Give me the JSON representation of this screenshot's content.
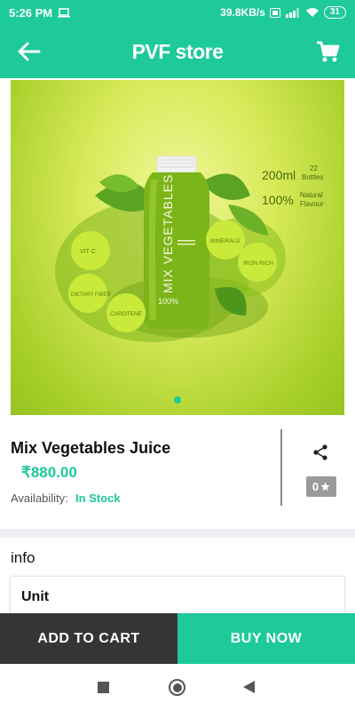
{
  "status_bar": {
    "time": "5:26 PM",
    "net_speed": "39.8KB/s",
    "battery": "31"
  },
  "app_bar": {
    "title": "PVF store",
    "back_icon": "arrow-left-icon",
    "cart_icon": "shopping-cart-icon"
  },
  "hero": {
    "bottle_label": "MIX VEGETABLES",
    "bottle_small": "100%",
    "volume": "200ml",
    "bottles_count": "22",
    "bottles_word": "Bottles",
    "natural_pct": "100%",
    "natural_word": "Natural",
    "flavour_word": "Flavour",
    "badges": [
      "VIT C",
      "DIETARY FIBER",
      "CAROTENE",
      "MINERALS",
      "IRON RICH"
    ],
    "slide_count": 1,
    "active_slide": 1
  },
  "product": {
    "name": "Mix Vegetables Juice",
    "price": "₹880.00",
    "availability_label": "Availability:",
    "availability_value": "In Stock",
    "rating": "0",
    "share_icon": "share-icon",
    "star_icon": "star-icon"
  },
  "info": {
    "title": "info",
    "unit_label": "Unit"
  },
  "actions": {
    "add_to_cart": "ADD TO CART",
    "buy_now": "BUY NOW"
  },
  "colors": {
    "primary": "#1ec99a",
    "dark_button": "#353535",
    "rating_badge": "#9a9a9a"
  }
}
